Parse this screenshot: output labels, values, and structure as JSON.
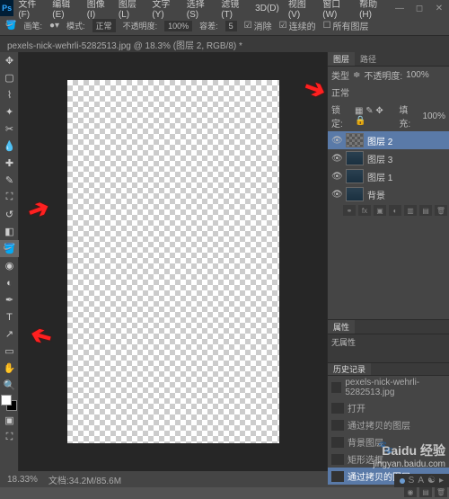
{
  "app": {
    "logo": "Ps"
  },
  "menu": {
    "file": "文件(F)",
    "edit": "编辑(E)",
    "image": "图像(I)",
    "layer": "图层(L)",
    "type": "文字(Y)",
    "select": "选择(S)",
    "filter": "滤镜(T)",
    "threeD": "3D(D)",
    "view": "视图(V)",
    "window": "窗口(W)",
    "help": "帮助(H)"
  },
  "options": {
    "brush_lbl": "画笔:",
    "mode_lbl": "模式:",
    "mode_val": "正常",
    "opacity_lbl": "不透明度:",
    "opacity_val": "100%",
    "tolerance_lbl": "容差:",
    "tolerance_val": "5",
    "contiguous": "连续的",
    "alllayers": "所有图层"
  },
  "tab": {
    "title": "pexels-nick-wehrli-5282513.jpg @ 18.3% (图层 2, RGB/8) *"
  },
  "layers_panel": {
    "tab_layers": "图层",
    "tab_paths": "路径",
    "kind": "类型",
    "blend": "正常",
    "opacity_lbl": "不透明度:",
    "opacity_val": "100%",
    "lock_lbl": "锁定:",
    "fill_lbl": "填充:",
    "fill_val": "100%",
    "items": [
      {
        "name": "图层 2",
        "sel": true,
        "thumb": "checker"
      },
      {
        "name": "图层 3",
        "sel": false,
        "thumb": "img"
      },
      {
        "name": "图层 1",
        "sel": false,
        "thumb": "img"
      },
      {
        "name": "背景",
        "sel": false,
        "thumb": "img"
      }
    ]
  },
  "props": {
    "tab": "属性",
    "none": "无属性"
  },
  "history": {
    "tab": "历史记录",
    "doc": "pexels-nick-wehrli-5282513.jpg",
    "items": [
      "打开",
      "通过拷贝的图层",
      "背景图层",
      "矩形选框",
      "通过拷贝的图层"
    ]
  },
  "status": {
    "zoom": "18.33%",
    "docinfo": "文档:34.2M/85.6M"
  },
  "watermark": {
    "brand": "Baidu 经验",
    "url": "jingyan.baidu.com"
  },
  "taskbar": {
    "s": "S",
    "a": "A"
  }
}
